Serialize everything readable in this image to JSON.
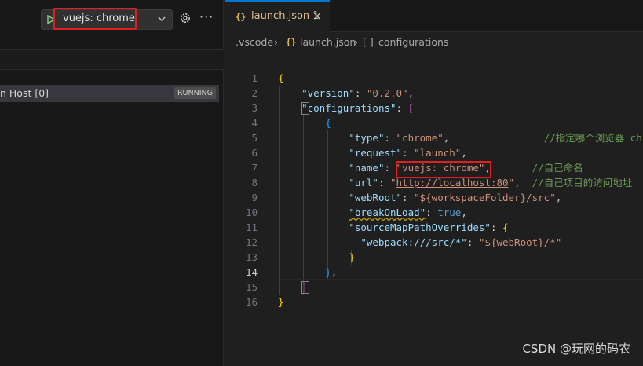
{
  "debug_toolbar": {
    "configuration_label": "vuejs: chrome"
  },
  "call_stack": {
    "session_label": "n Host [0]",
    "status_badge": "RUNNING"
  },
  "tab": {
    "icon_glyph": "{}",
    "title": "launch.json",
    "problem_count": "1"
  },
  "breadcrumbs": {
    "folder": ".vscode",
    "file_icon": "{}",
    "file": "launch.json",
    "array_icon": "[ ]",
    "symbol": "configurations",
    "separator": "›"
  },
  "code": {
    "active_line": 14,
    "line_numbers": [
      "1",
      "2",
      "3",
      "4",
      "5",
      "6",
      "7",
      "8",
      "9",
      "10",
      "11",
      "12",
      "13",
      "14",
      "15",
      "16"
    ],
    "l1": "{",
    "l2_key": "\"version\"",
    "l2_val": "\"0.2.0\"",
    "l3_key": "\"configurations\"",
    "l3_open": "[",
    "l4": "{",
    "l5_key": "\"type\"",
    "l5_val": "\"chrome\"",
    "l5_comment": "//指定哪个浏览器 ch",
    "l6_key": "\"request\"",
    "l6_val": "\"launch\"",
    "l7_key": "\"name\"",
    "l7_val": "\"vuejs: chrome\"",
    "l7_comment": "//自己命名",
    "l8_key": "\"url\"",
    "l8_q1": "\"",
    "l8_val": "http://localhost:80",
    "l8_q2": "\"",
    "l8_comment": "//自己项目的访问地址",
    "l9_key": "\"webRoot\"",
    "l9_val": "\"${workspaceFolder}/src\"",
    "l10_key": "\"breakOnLoad\"",
    "l10_val": "true",
    "l11_key": "\"sourceMapPathOverrides\"",
    "l11_open": "{",
    "l12_key": "\"webpack:///src/*\"",
    "l12_val": "\"${webRoot}/*\"",
    "l13": "}",
    "l14": "}",
    "l15": "]",
    "l16": "}"
  },
  "watermark": "CSDN @玩网的码农",
  "colors": {
    "annotation_red": "#e02020",
    "accent_blue": "#0078d4",
    "json_key": "#9cdcfe",
    "json_string": "#ce9178",
    "comment": "#6a9955"
  }
}
